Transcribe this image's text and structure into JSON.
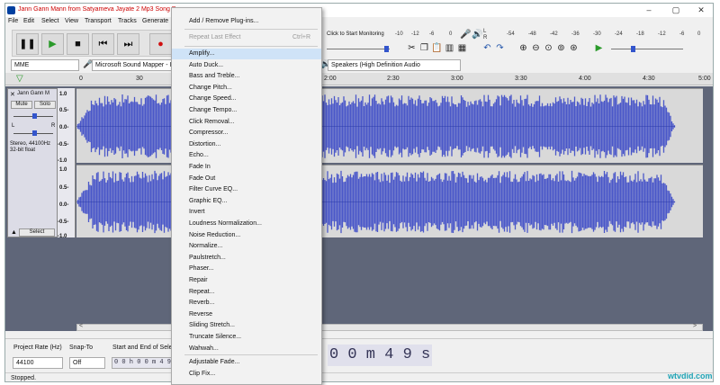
{
  "window": {
    "title": "Jann Gann Mann from Satyameva Jayate 2 Mp3 Song Do",
    "controls": [
      "–",
      "▢",
      "✕"
    ]
  },
  "menubar": [
    "File",
    "Edit",
    "Select",
    "View",
    "Transport",
    "Tracks",
    "Generate"
  ],
  "transport": {
    "buttons": [
      "pause",
      "play",
      "stop",
      "skip-start",
      "skip-end",
      "record"
    ]
  },
  "meter": {
    "monitor_label": "Click to Start Monitoring",
    "left_ticks": [
      "-10",
      "-12",
      "-6",
      "0"
    ],
    "right_ticks": [
      "-54",
      "-48",
      "-42",
      "-36",
      "-30",
      "-24",
      "-18",
      "-12",
      "-6",
      "0"
    ],
    "lr_top": "L",
    "lr_bottom": "R"
  },
  "devices": {
    "host": "MME",
    "input": "Microsoft Sound Mapper - I",
    "output": "Speakers (High Definition Audio"
  },
  "timeline": {
    "left_ticks": [
      "0",
      "30"
    ],
    "right_ticks": [
      "2:00",
      "2:30",
      "3:00",
      "3:30",
      "4:00",
      "4:30",
      "5:00"
    ]
  },
  "track": {
    "name": "Jann Gann M",
    "close": "✕",
    "mute": "Mute",
    "solo": "Solo",
    "pan_l": "L",
    "pan_r": "R",
    "info1": "Stereo, 44100Hz",
    "info2": "32-bit float",
    "select": "Select",
    "scale_upper": [
      "1.0",
      "0.5-",
      "0.0-",
      "-0.5-",
      "-1.0"
    ],
    "scale_lower": [
      "1.0",
      "0.5-",
      "0.0-",
      "-0.5-",
      "-1.0"
    ],
    "colors": {
      "wave": "#4a57c9",
      "wave_bg": "#d9d9d9",
      "empty": "#5f6679"
    }
  },
  "selection": {
    "project_rate_label": "Project Rate (Hz)",
    "snap_label": "Snap-To",
    "range_label": "Start and End of Selec",
    "rate_value": "44100",
    "snap_value": "Off",
    "start_time": "0 0 h 0 0 m 4 9 .4",
    "big_time": "0 0 m 4 9 s"
  },
  "status": "Stopped.",
  "effects_menu": {
    "top_items": [
      {
        "label": "Add / Remove Plug-ins...",
        "shortcut": ""
      },
      {
        "label": "Repeat Last Effect",
        "shortcut": "Ctrl+R"
      }
    ],
    "items": [
      "Amplify...",
      "Auto Duck...",
      "Bass and Treble...",
      "Change Pitch...",
      "Change Speed...",
      "Change Tempo...",
      "Click Removal...",
      "Compressor...",
      "Distortion...",
      "Echo...",
      "Fade In",
      "Fade Out",
      "Filter Curve EQ...",
      "Graphic EQ...",
      "Invert",
      "Loudness Normalization...",
      "Noise Reduction...",
      "Normalize...",
      "Paulstretch...",
      "Phaser...",
      "Repair",
      "Repeat...",
      "Reverb...",
      "Reverse",
      "Sliding Stretch...",
      "Truncate Silence...",
      "Wahwah..."
    ],
    "bottom_items": [
      "Adjustable Fade...",
      "Clip Fix..."
    ],
    "highlighted": "Amplify..."
  },
  "watermark": "wtvdid.com"
}
